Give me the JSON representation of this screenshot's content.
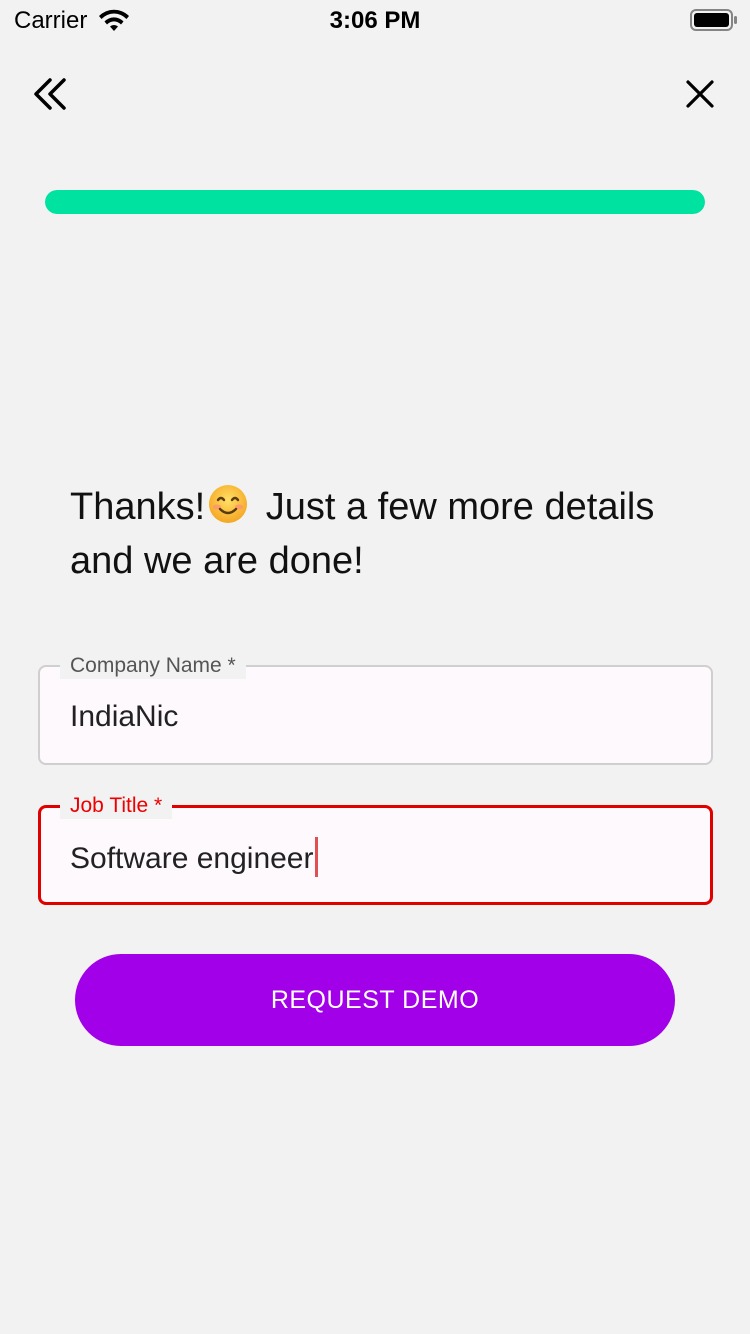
{
  "status_bar": {
    "carrier": "Carrier",
    "time": "3:06 PM"
  },
  "nav": {
    "back_icon": "double-chevron-left-icon",
    "close_icon": "close-icon"
  },
  "progress": {
    "value_percent": 100,
    "color": "#00e3a0"
  },
  "headline": {
    "line1_pre": "Thanks!",
    "emoji": "smiling-face-emoji",
    "line1_post": "Just a few more details",
    "line2": "and we are done!"
  },
  "form": {
    "company": {
      "label": "Company Name *",
      "value": "IndiaNic"
    },
    "job_title": {
      "label": "Job Title *",
      "value": "Software engineer",
      "error_color": "#ee0000"
    }
  },
  "cta": {
    "label": "REQUEST DEMO",
    "color": "#a100e8"
  }
}
